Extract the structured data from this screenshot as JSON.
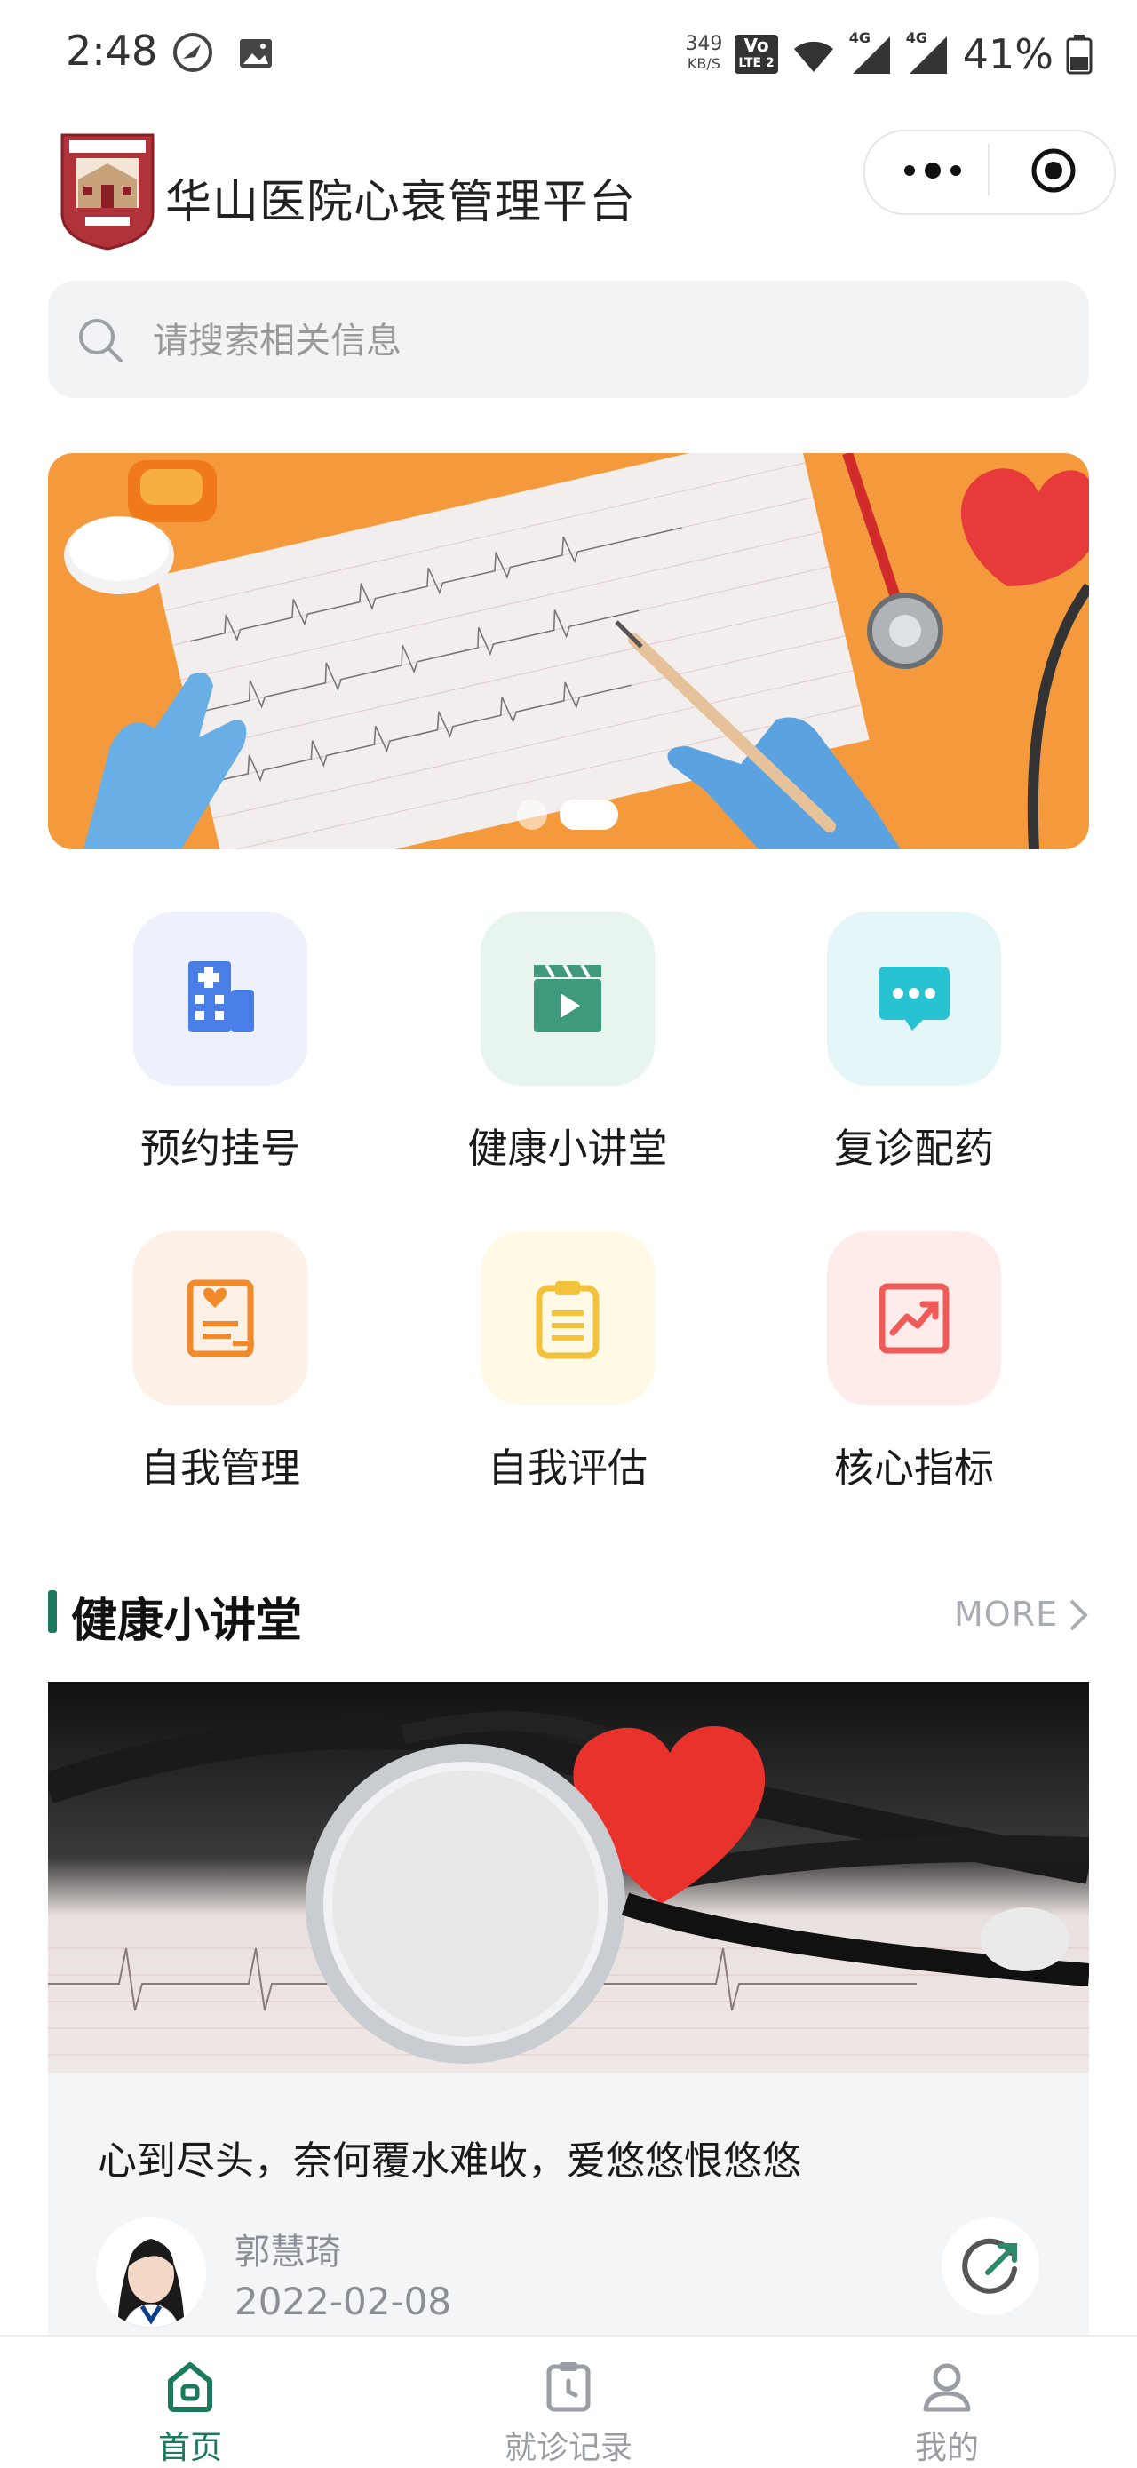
{
  "status_bar": {
    "time": "2:48",
    "net_speed_value": "349",
    "net_speed_unit": "KB/S",
    "volte_top": "Vo",
    "volte_bottom": "LTE 2",
    "net_4g_1": "4G",
    "net_4g_2": "4G",
    "battery": "41%"
  },
  "header": {
    "title": "华山医院心衰管理平台"
  },
  "search": {
    "placeholder": "请搜索相关信息"
  },
  "banner": {
    "slide_count": 2,
    "active_slide": 2
  },
  "quick_actions": [
    {
      "label": "预约挂号",
      "icon": "hospital-building-icon",
      "bg": "#eef1fb",
      "color": "#4a7fe8"
    },
    {
      "label": "健康小讲堂",
      "icon": "video-clapper-icon",
      "bg": "#e8f5ef",
      "color": "#3f9a7d"
    },
    {
      "label": "复诊配药",
      "icon": "chat-bubble-icon",
      "bg": "#e4f6f8",
      "color": "#27c3d3"
    },
    {
      "label": "自我管理",
      "icon": "profile-card-icon",
      "bg": "#fdf0e6",
      "color": "#f08a2a"
    },
    {
      "label": "自我评估",
      "icon": "clipboard-icon",
      "bg": "#fff9e6",
      "color": "#f2c23a"
    },
    {
      "label": "核心指标",
      "icon": "trend-chart-icon",
      "bg": "#fdecea",
      "color": "#ee5b58"
    }
  ],
  "section": {
    "title": "健康小讲堂",
    "more_label": "MORE"
  },
  "article": {
    "title": "心到尽头，奈何覆水难收，爱悠悠恨悠悠",
    "author": "郭慧琦",
    "date": "2022-02-08"
  },
  "tabbar": {
    "items": [
      {
        "label": "首页",
        "icon": "home-icon",
        "active": true
      },
      {
        "label": "就诊记录",
        "icon": "clipboard-clock-icon",
        "active": false
      },
      {
        "label": "我的",
        "icon": "user-icon",
        "active": false
      }
    ],
    "active_color": "#1b7a5e",
    "inactive_color": "#9a9ea4"
  },
  "colors": {
    "brand": "#1b7a5e",
    "banner_bg": "#f59a3c"
  }
}
